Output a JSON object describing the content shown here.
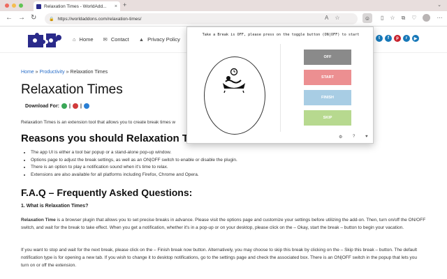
{
  "browser": {
    "tab_title": "Relaxation Times - WorldAdd...",
    "url": "https://worldaddons.com/relaxation-times/",
    "new_tab": "+",
    "tab_close": "×"
  },
  "site": {
    "nav": [
      {
        "label": "Home",
        "icon": "home-icon"
      },
      {
        "label": "Contact",
        "icon": "mail-icon"
      },
      {
        "label": "Privacy Policy",
        "icon": "graduation-cap-icon"
      }
    ],
    "social": [
      "twitter-icon",
      "facebook-icon",
      "pinterest-icon",
      "reddit-icon",
      "youtube-icon"
    ]
  },
  "breadcrumb": {
    "home": "Home",
    "sep1": " » ",
    "category": "Productivity",
    "sep2": " » ",
    "current": "Relaxation Times"
  },
  "article": {
    "title": "Relaxation Times",
    "download_label": "Download For:",
    "intro": "Relaxation Times is an extension tool that allows you to create break times w",
    "reasons_heading": "Reasons you should Relaxation Times",
    "reasons": [
      "The app UI is either a tool bar popup or a stand-alone pop-up window.",
      "Options page to adjust the break settings, as well as an ON|OFF switch to enable or disable the plugin.",
      "There is an option to play a notification sound when it's time to relax.",
      "Extensions are also available for all platforms including Firefox, Chrome and Opera."
    ],
    "faq_heading": "F.A.Q – Frequently Asked Questions:",
    "q1": "1. What is Relaxation Times?",
    "p1_bold": "Relaxation Time",
    "p1": " is a browser plugin that allows you to set precise breaks in advance. Please visit the options page and customize your settings before utilizing the add-on. Then, turn on/off the ON/OFF switch, and wait for the break to take effect. When you get a notification, whether it's in a pop-up or on your desktop, please click on the – Okay, start the break – button to begin your vacation.",
    "p2": "If you want to stop and wait for the next break, please click on the – Finish break now button. Alternatively, you may choose to skip this break by clicking on the – Skip this break – button. The default notification type is for opening a new tab. If you wish to change it to desktop notifications, go to the settings page and check the associated box. There is an ON|OFF switch in the popup that lets you turn on or off the extension."
  },
  "popup": {
    "message": "Take a Break is OFF, please press on the toggle button (ON|OFF) to start",
    "buttons": [
      {
        "label": "OFF",
        "color": "#8a8a8a"
      },
      {
        "label": "START",
        "color": "#ec8f91"
      },
      {
        "label": "FINISH",
        "color": "#a8cde4"
      },
      {
        "label": "SKIP",
        "color": "#b7d98f"
      }
    ],
    "footer": [
      "⚙",
      "?",
      "♥"
    ]
  }
}
